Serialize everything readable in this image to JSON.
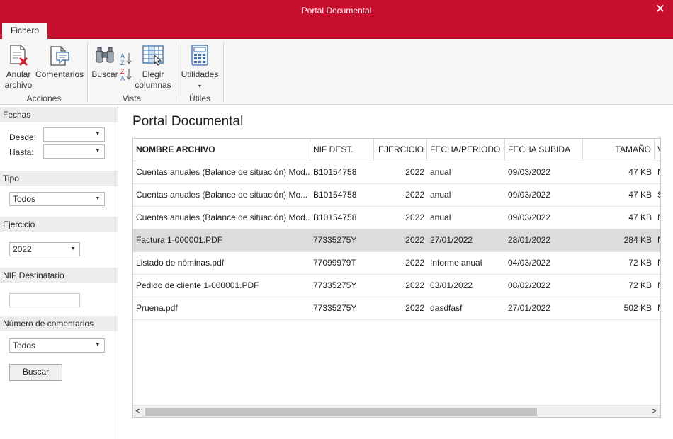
{
  "window": {
    "title": "Portal Documental",
    "close": "✕"
  },
  "tabs": [
    {
      "label": "Fichero"
    }
  ],
  "ribbon": {
    "groups": [
      {
        "label": "Acciones"
      },
      {
        "label": "Vista"
      },
      {
        "label": "Útiles"
      }
    ],
    "buttons": {
      "anular_1": "Anular",
      "anular_2": "archivo",
      "comentarios": "Comentarios",
      "buscar": "Buscar",
      "elegir_1": "Elegir",
      "elegir_2": "columnas",
      "utilidades": "Utilidades",
      "utilidades_arrow": "▾"
    }
  },
  "filters": {
    "fechas": {
      "title": "Fechas",
      "desde_label": "Desde:",
      "hasta_label": "Hasta:",
      "desde_value": "",
      "hasta_value": ""
    },
    "tipo": {
      "title": "Tipo",
      "value": "Todos"
    },
    "ejercicio": {
      "title": "Ejercicio",
      "value": "2022"
    },
    "nif": {
      "title": "NIF Destinatario",
      "value": ""
    },
    "comentarios": {
      "title": "Número de comentarios",
      "value": "Todos"
    },
    "search_button": "Buscar",
    "dropdown_arrow": "▼"
  },
  "main": {
    "title": "Portal Documental"
  },
  "table": {
    "columns": [
      "NOMBRE ARCHIVO",
      "NIF DEST.",
      "EJERCICIO",
      "FECHA/PERIODO",
      "FECHA SUBIDA",
      "TAMAÑO",
      "V"
    ],
    "rows": [
      [
        "Cuentas anuales (Balance de situación) Mod...",
        "B10154758",
        "2022",
        "anual",
        "09/03/2022",
        "47 KB",
        "N"
      ],
      [
        "Cuentas anuales (Balance de situación) Mo...",
        "B10154758",
        "2022",
        "anual",
        "09/03/2022",
        "47 KB",
        "S"
      ],
      [
        "Cuentas anuales (Balance de situación) Mod...",
        "B10154758",
        "2022",
        "anual",
        "09/03/2022",
        "47 KB",
        "N"
      ],
      [
        "Factura 1-000001.PDF",
        "77335275Y",
        "2022",
        "27/01/2022",
        "28/01/2022",
        "284 KB",
        "N"
      ],
      [
        "Listado de nóminas.pdf",
        "77099979T",
        "2022",
        "Informe anual",
        "04/03/2022",
        "72 KB",
        "N"
      ],
      [
        "Pedido de cliente 1-000001.PDF",
        "77335275Y",
        "2022",
        "03/01/2022",
        "08/02/2022",
        "72 KB",
        "N"
      ],
      [
        "Pruena.pdf",
        "77335275Y",
        "2022",
        "dasdfasf",
        "27/01/2022",
        "502 KB",
        "N"
      ]
    ],
    "selected_row": 3,
    "scroll_left": "<",
    "scroll_right": ">"
  },
  "colors": {
    "accent": "#c8102e",
    "selected_row": "#dcdcdc",
    "panel_header": "#ececec"
  }
}
